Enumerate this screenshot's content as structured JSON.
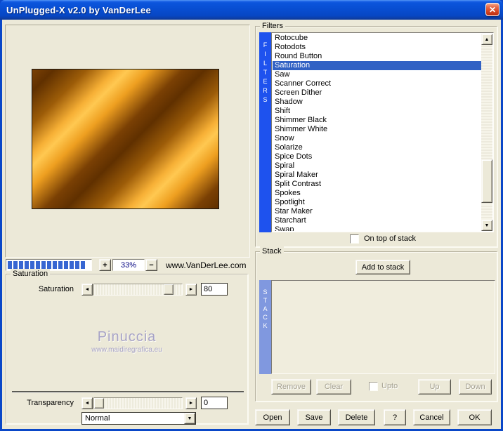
{
  "window": {
    "title": "UnPlugged-X v2.0 by VanDerLee"
  },
  "icons": {
    "close": "✕",
    "arrow_left": "◄",
    "arrow_right": "►",
    "arrow_up": "▲",
    "arrow_down": "▼",
    "plus": "+",
    "minus": "−"
  },
  "preview": {
    "zoom_level": "33%",
    "website": "www.VanDerLee.com",
    "watermark_name": "Pinuccia",
    "watermark_url": "www.maidiregrafica.eu"
  },
  "saturation_group": {
    "title": "Saturation",
    "saturation": {
      "label": "Saturation",
      "value": "80"
    },
    "transparency": {
      "label": "Transparency",
      "value": "0"
    },
    "blend_mode": "Normal"
  },
  "filters_group": {
    "title": "Filters",
    "vertical_label": "FILTERS",
    "items": [
      "Rotocube",
      "Rotodots",
      "Round Button",
      "Saturation",
      "Saw",
      "Scanner Correct",
      "Screen Dither",
      "Shadow",
      "Shift",
      "Shimmer Black",
      "Shimmer White",
      "Snow",
      "Solarize",
      "Spice Dots",
      "Spiral",
      "Spiral Maker",
      "Split Contrast",
      "Spokes",
      "Spotlight",
      "Star Maker",
      "Starchart",
      "Swap"
    ],
    "selected_item": "Saturation",
    "on_top_label": "On top of stack"
  },
  "stack_group": {
    "title": "Stack",
    "vertical_label": "STACK",
    "add_button": "Add to stack",
    "remove_button": "Remove",
    "clear_button": "Clear",
    "upto_label": "Upto",
    "up_button": "Up",
    "down_button": "Down"
  },
  "footer": {
    "open": "Open",
    "save": "Save",
    "delete": "Delete",
    "help": "?",
    "cancel": "Cancel",
    "ok": "OK"
  },
  "colors": {
    "selection": "#3161C4",
    "filters_bar": "#1E52EE",
    "stack_bar": "#8098DF",
    "progress_segment": "#3766D2",
    "zoom_text": "#000080",
    "dialog_background": "#ECE9D8"
  }
}
